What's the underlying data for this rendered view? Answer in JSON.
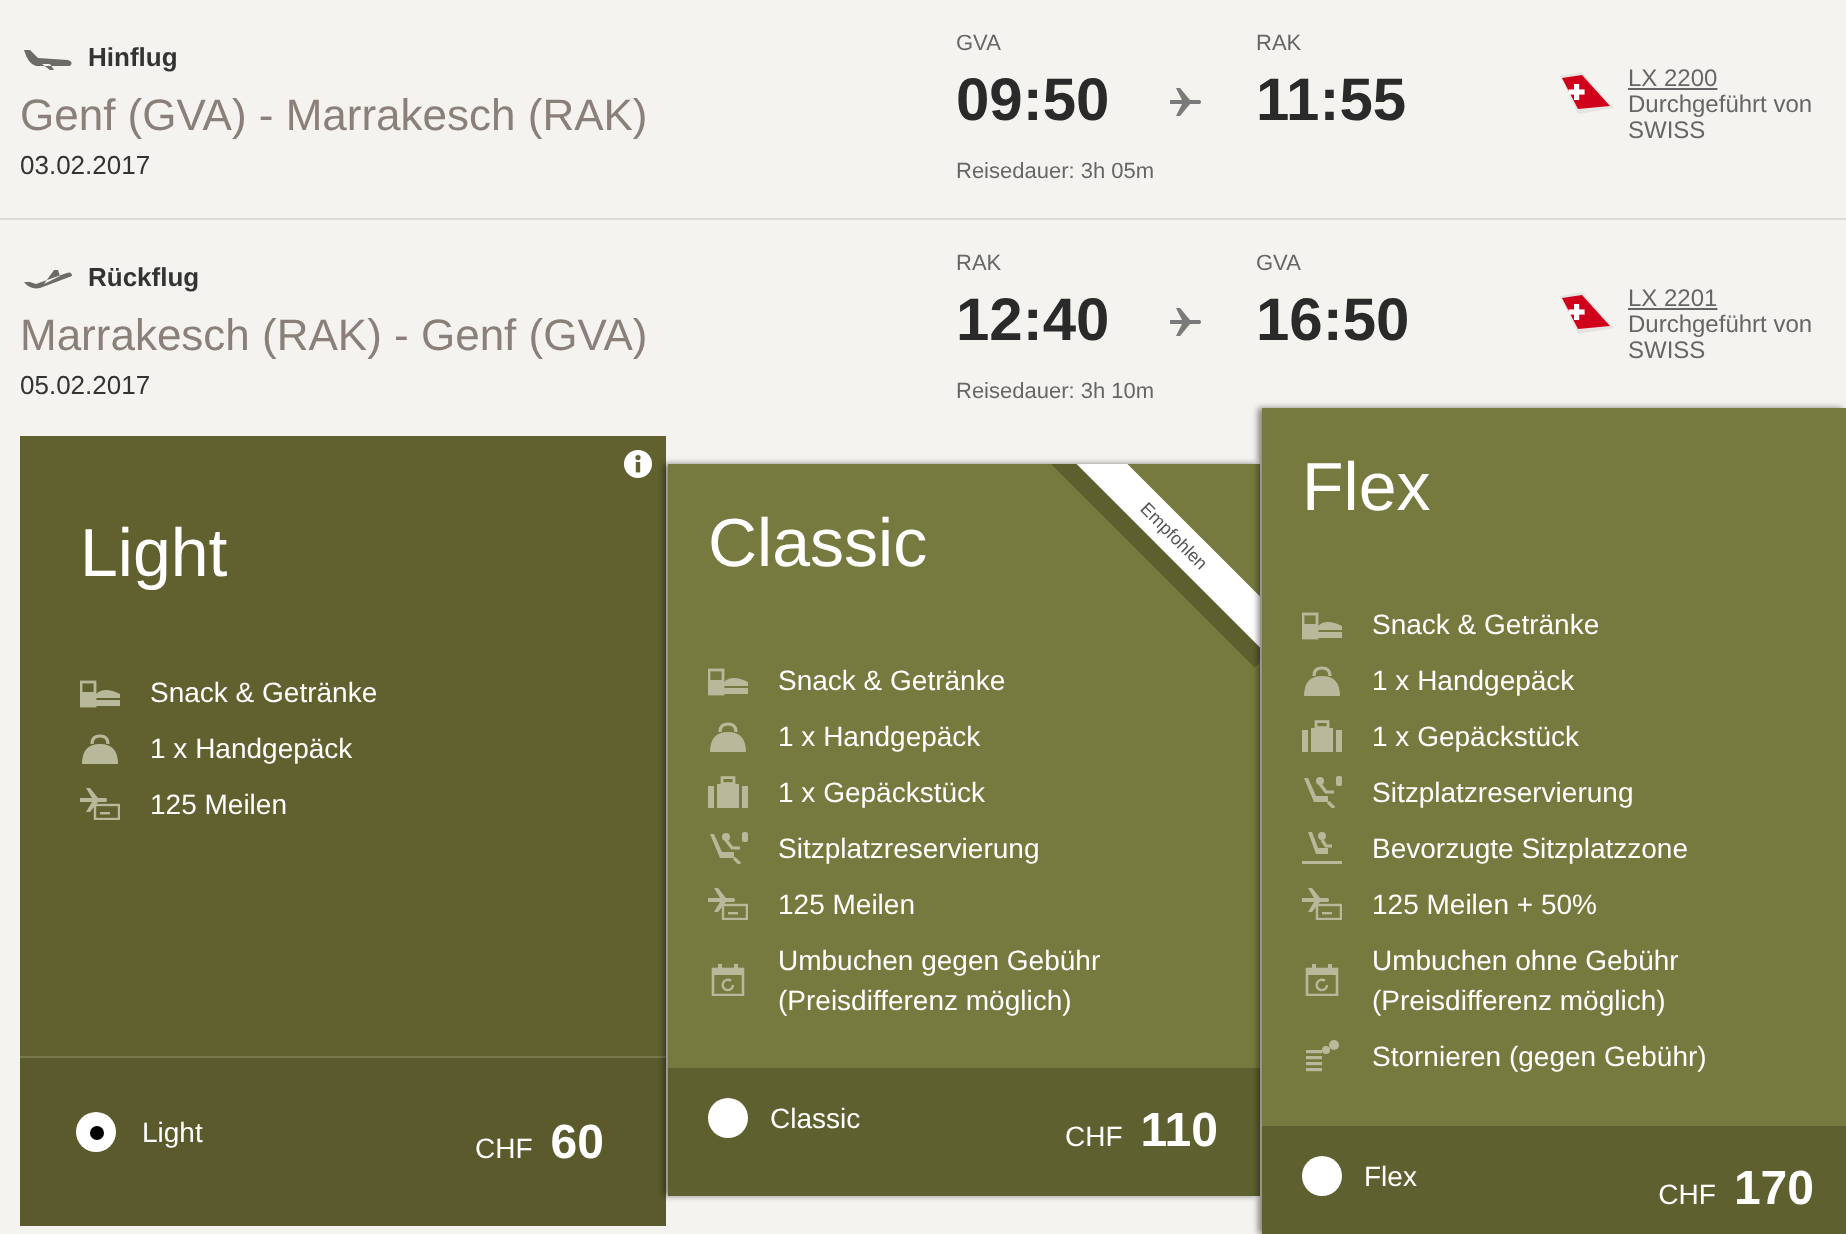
{
  "flights": [
    {
      "kind": "outbound",
      "label": "Hinflug",
      "route": "Genf (GVA) - Marrakesch (RAK)",
      "date": "03.02.2017",
      "departure": {
        "airport": "GVA",
        "time": "09:50"
      },
      "arrival": {
        "airport": "RAK",
        "time": "11:55"
      },
      "duration": "Reisedauer: 3h 05m",
      "flight_number": "LX 2200",
      "operator": "Durchgeführt von SWISS"
    },
    {
      "kind": "return",
      "label": "Rückflug",
      "route": "Marrakesch (RAK) - Genf (GVA)",
      "date": "05.02.2017",
      "departure": {
        "airport": "RAK",
        "time": "12:40"
      },
      "arrival": {
        "airport": "GVA",
        "time": "16:50"
      },
      "duration": "Reisedauer: 3h 10m",
      "flight_number": "LX 2201",
      "operator": "Durchgeführt von SWISS"
    }
  ],
  "fares": [
    {
      "name": "Light",
      "selected": true,
      "info_button": true,
      "features": [
        {
          "kind": "snack",
          "text": "Snack & Getränke"
        },
        {
          "kind": "handbag",
          "text": "1 x Handgepäck"
        },
        {
          "kind": "miles",
          "text": "125 Meilen"
        }
      ],
      "option_label": "Light",
      "currency": "CHF",
      "price": "60"
    },
    {
      "name": "Classic",
      "selected": false,
      "badge": "Empfohlen",
      "features": [
        {
          "kind": "snack",
          "text": "Snack & Getränke"
        },
        {
          "kind": "handbag",
          "text": "1 x Handgepäck"
        },
        {
          "kind": "suitcase",
          "text": "1 x Gepäckstück"
        },
        {
          "kind": "seat",
          "text": "Sitzplatzreservierung"
        },
        {
          "kind": "miles",
          "text": "125 Meilen"
        },
        {
          "kind": "rebook",
          "text": "Umbuchen gegen Gebühr (Preisdifferenz möglich)"
        }
      ],
      "option_label": "Classic",
      "currency": "CHF",
      "price": "110"
    },
    {
      "name": "Flex",
      "selected": false,
      "features": [
        {
          "kind": "snack",
          "text": "Snack & Getränke"
        },
        {
          "kind": "handbag",
          "text": "1 x Handgepäck"
        },
        {
          "kind": "suitcase",
          "text": "1 x Gepäckstück"
        },
        {
          "kind": "seat",
          "text": "Sitzplatzreservierung"
        },
        {
          "kind": "preferred_seat",
          "text": "Bevorzugte Sitzplatzzone"
        },
        {
          "kind": "miles",
          "text": "125 Meilen + 50%"
        },
        {
          "kind": "rebook",
          "text": "Umbuchen ohne Gebühr (Preisdifferenz möglich)"
        },
        {
          "kind": "cancel",
          "text": "Stornieren (gegen Gebühr)"
        }
      ],
      "option_label": "Flex",
      "currency": "CHF",
      "price": "170"
    }
  ]
}
